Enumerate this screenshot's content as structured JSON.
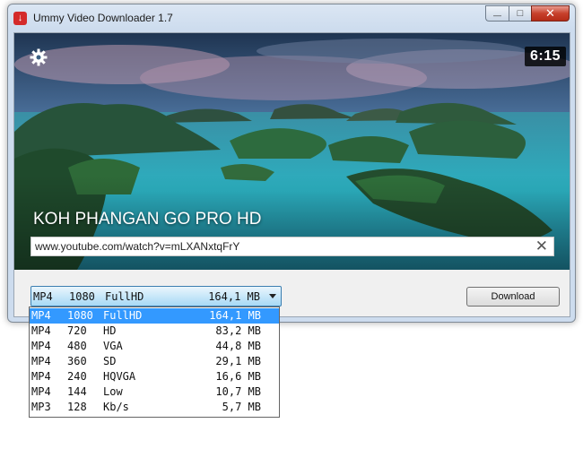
{
  "window": {
    "title": "Ummy Video Downloader 1.7",
    "controls": {
      "minimize": "—",
      "maximize": "□",
      "close": "✕"
    }
  },
  "video": {
    "duration": "6:15",
    "title": "KOH PHANGAN GO PRO HD",
    "url": "www.youtube.com/watch?v=mLXANxtqFrY"
  },
  "icons": {
    "app": "ummy-download-icon",
    "settings": "gear-icon",
    "clear": "close-icon",
    "dropdown": "chevron-down-icon"
  },
  "format_select": {
    "selected": {
      "format": "MP4",
      "res": "1080",
      "quality": "FullHD",
      "size": "164,1 MB"
    }
  },
  "format_options": [
    {
      "format": "MP4",
      "res": "1080",
      "quality": "FullHD",
      "size": "164,1 MB"
    },
    {
      "format": "MP4",
      "res": "720",
      "quality": "HD",
      "size": "83,2 MB"
    },
    {
      "format": "MP4",
      "res": "480",
      "quality": "VGA",
      "size": "44,8 MB"
    },
    {
      "format": "MP4",
      "res": "360",
      "quality": "SD",
      "size": "29,1 MB"
    },
    {
      "format": "MP4",
      "res": "240",
      "quality": "HQVGA",
      "size": "16,6 MB"
    },
    {
      "format": "MP4",
      "res": "144",
      "quality": "Low",
      "size": "10,7 MB"
    },
    {
      "format": "MP3",
      "res": "128",
      "quality": "Kb/s",
      "size": "5,7 MB"
    }
  ],
  "download_button": {
    "label": "Download"
  },
  "colors": {
    "highlight": "#3399ff",
    "sea": "#2aa6b8",
    "sky": "#2d4f78"
  }
}
